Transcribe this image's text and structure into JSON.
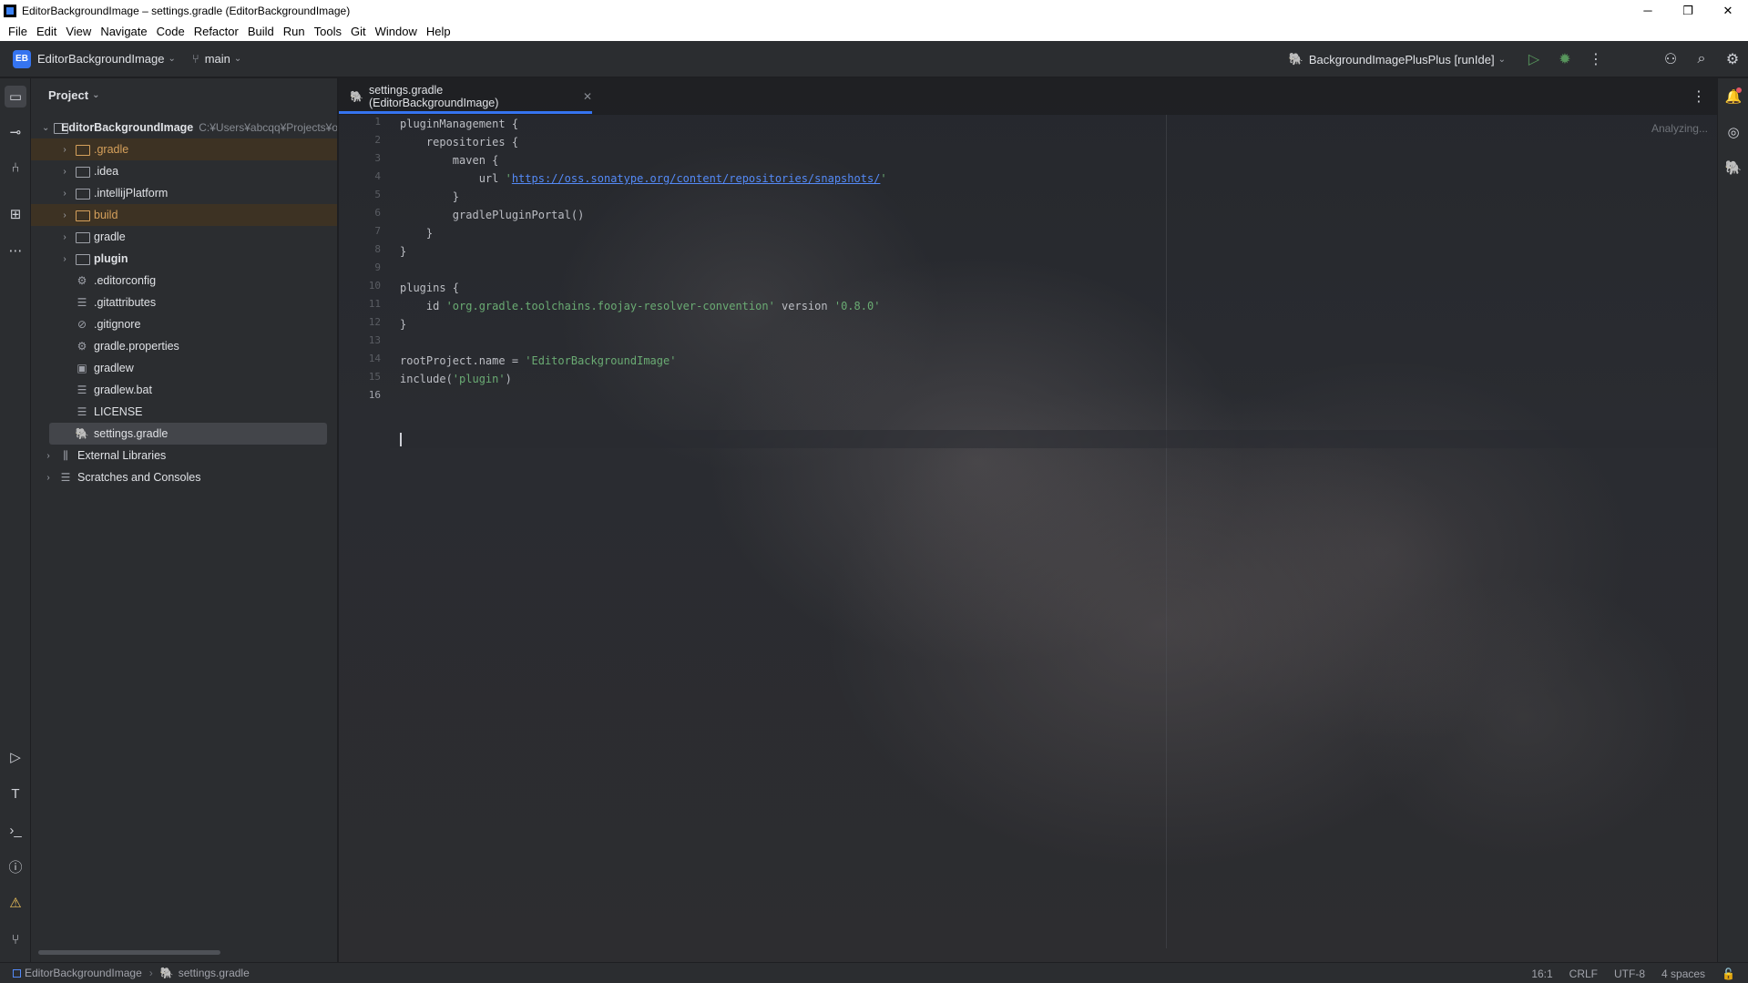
{
  "window": {
    "title": "EditorBackgroundImage – settings.gradle (EditorBackgroundImage)",
    "minimize": "─",
    "restore": "❐",
    "close": "✕"
  },
  "menu": [
    "File",
    "Edit",
    "View",
    "Navigate",
    "Code",
    "Refactor",
    "Build",
    "Run",
    "Tools",
    "Git",
    "Window",
    "Help"
  ],
  "toolbar": {
    "project_badge": "EB",
    "project_name": "EditorBackgroundImage",
    "branch": "main",
    "run_config": "BackgroundImagePlusPlus [runIde]"
  },
  "project_panel": {
    "title": "Project",
    "root": {
      "name": "EditorBackgroundImage",
      "path": "C:¥Users¥abcqq¥Projects¥o"
    },
    "items": [
      {
        "name": ".gradle",
        "type": "folder",
        "excluded": true
      },
      {
        "name": ".idea",
        "type": "folder",
        "excluded": false
      },
      {
        "name": ".intellijPlatform",
        "type": "folder",
        "excluded": false
      },
      {
        "name": "build",
        "type": "folder",
        "excluded": true
      },
      {
        "name": "gradle",
        "type": "folder",
        "excluded": false
      },
      {
        "name": "plugin",
        "type": "module",
        "excluded": false
      },
      {
        "name": ".editorconfig",
        "type": "config"
      },
      {
        "name": ".gitattributes",
        "type": "text"
      },
      {
        "name": ".gitignore",
        "type": "ignore"
      },
      {
        "name": "gradle.properties",
        "type": "config"
      },
      {
        "name": "gradlew",
        "type": "script"
      },
      {
        "name": "gradlew.bat",
        "type": "text"
      },
      {
        "name": "LICENSE",
        "type": "text"
      },
      {
        "name": "settings.gradle",
        "type": "gradle",
        "selected": true
      }
    ],
    "external_libraries": "External Libraries",
    "scratches": "Scratches and Consoles"
  },
  "editor": {
    "tab_label": "settings.gradle (EditorBackgroundImage)",
    "status": "Analyzing...",
    "line_numbers": [
      "1",
      "2",
      "3",
      "4",
      "5",
      "6",
      "7",
      "8",
      "9",
      "10",
      "11",
      "12",
      "13",
      "14",
      "15",
      "16"
    ],
    "lines": [
      "pluginManagement {",
      "    repositories {",
      "        maven {",
      "            url ",
      "        }",
      "        gradlePluginPortal()",
      "    }",
      "}",
      "",
      "plugins {",
      "    id ",
      "}",
      "",
      "rootProject.name = ",
      "include(",
      ""
    ],
    "maven_url": "'https://oss.sonatype.org/content/repositories/snapshots/'",
    "plugin_id": "'org.gradle.toolchains.foojay-resolver-convention'",
    "version_kw": " version ",
    "plugin_version": "'0.8.0'",
    "root_name": "'EditorBackgroundImage'",
    "include_arg": "'plugin'",
    "include_close": ")"
  },
  "statusbar": {
    "breadcrumb_project": "EditorBackgroundImage",
    "breadcrumb_file": "settings.gradle",
    "position": "16:1",
    "line_ending": "CRLF",
    "encoding": "UTF-8",
    "indent": "4 spaces"
  }
}
